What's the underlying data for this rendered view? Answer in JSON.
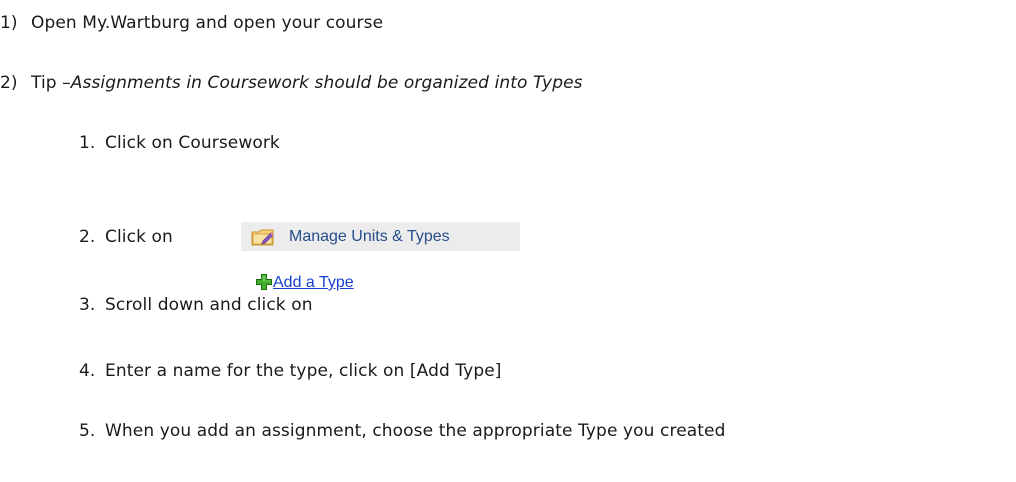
{
  "steps": [
    {
      "num": "1)",
      "text": "Open My.Wartburg and open your course"
    },
    {
      "num": "2)",
      "prefix": "Tip – ",
      "italic": "Assignments in Coursework should be organized into Types"
    }
  ],
  "substeps": [
    {
      "num": "1.",
      "text": "Click on Coursework"
    },
    {
      "num": "2.",
      "text": "Click on"
    },
    {
      "num": "3.",
      "text": "Scroll down and click on"
    },
    {
      "num": "4.",
      "text": "Enter a name for the type, click on [Add Type]"
    },
    {
      "num": "5.",
      "text": "When you add an assignment, choose the appropriate Type you created"
    }
  ],
  "manage_button": {
    "label": "Manage Units & Types",
    "icon": "edit-folder-icon",
    "background": "#ececec",
    "text_color": "#274d8c"
  },
  "add_type_link": {
    "label": "Add a Type",
    "icon": "green-plus-icon",
    "text_color": "#1a3fd1"
  }
}
